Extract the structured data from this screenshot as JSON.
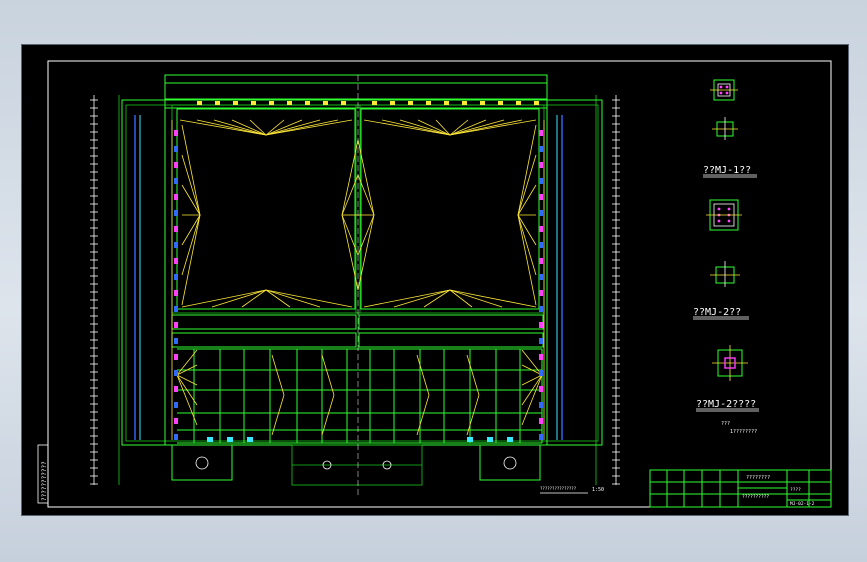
{
  "title_blocks": {
    "detail_1": "??MJ-1??",
    "detail_2": "??MJ-2??",
    "detail_3": "??MJ-2????",
    "note_label": "???",
    "note_text": "1????????"
  },
  "plan": {
    "plan_title": "???????????????",
    "plan_scale": "1:50",
    "side_note": "???????????"
  },
  "title_block_cells": {
    "project": "????????",
    "drawing_name": "??????????",
    "drawing_no": "????",
    "sheet_no": "MJ-02-1-2"
  },
  "colors": {
    "background": "#000000",
    "grid_lines": "#2fff2f",
    "members": "#ffe838",
    "columns_blue": "#2f6bff",
    "columns_magenta": "#ff40ff",
    "annotation": "#ffffff"
  }
}
